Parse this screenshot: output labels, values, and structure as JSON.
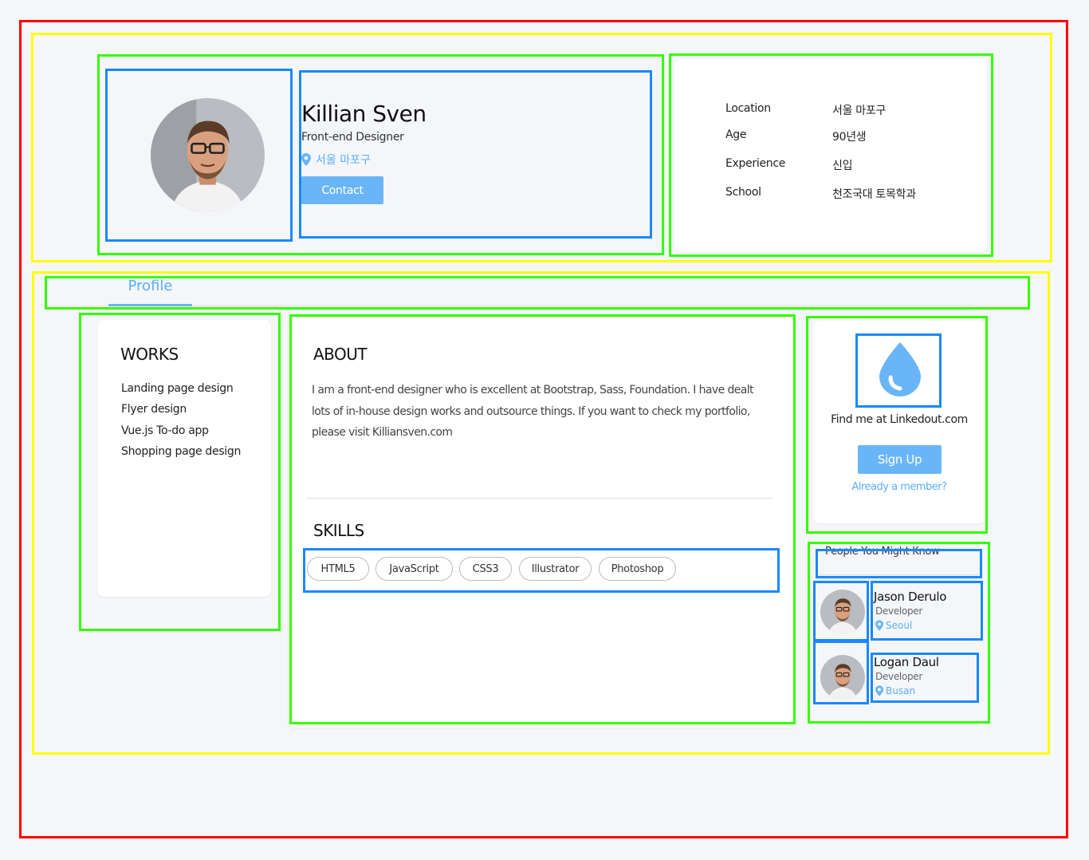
{
  "profile": {
    "name": "Killian Sven",
    "role": "Front-end Designer",
    "location": "서울 마포구",
    "contact_label": "Contact",
    "avatar_icon": "person-avatar"
  },
  "info": [
    {
      "label": "Location",
      "value": "서울 마포구"
    },
    {
      "label": "Age",
      "value": "90년생"
    },
    {
      "label": "Experience",
      "value": "신입"
    },
    {
      "label": "School",
      "value": "천조국대 토목학과"
    }
  ],
  "tabs": [
    {
      "label": "Profile",
      "active": true
    }
  ],
  "works": {
    "title": "WORKS",
    "items": [
      "Landing page design",
      "Flyer design",
      "Vue.js To-do app",
      "Shopping page design"
    ]
  },
  "about": {
    "title": "ABOUT",
    "text": "I am a front-end designer who is excellent at Bootstrap, Sass, Foundation. I have dealt lots of in-house design works and outsource things. If you want to check my portfolio, please visit Killiansven.com"
  },
  "skills": {
    "title": "SKILLS",
    "items": [
      "HTML5",
      "JavaScript",
      "CSS3",
      "Illustrator",
      "Photoshop"
    ]
  },
  "linkedout": {
    "icon": "water-drop-icon",
    "text": "Find me at Linkedout.com",
    "signup_label": "Sign Up",
    "member_link": "Already a member?"
  },
  "people": {
    "title": "People You Might Know",
    "list": [
      {
        "name": "Jason Derulo",
        "role": "Developer",
        "city": "Seoul"
      },
      {
        "name": "Logan Daul",
        "role": "Developer",
        "city": "Busan"
      }
    ]
  },
  "colors": {
    "accent": "#6ab5f7",
    "accent_text": "#5aaef7",
    "page_bg": "#f4f6fa"
  }
}
